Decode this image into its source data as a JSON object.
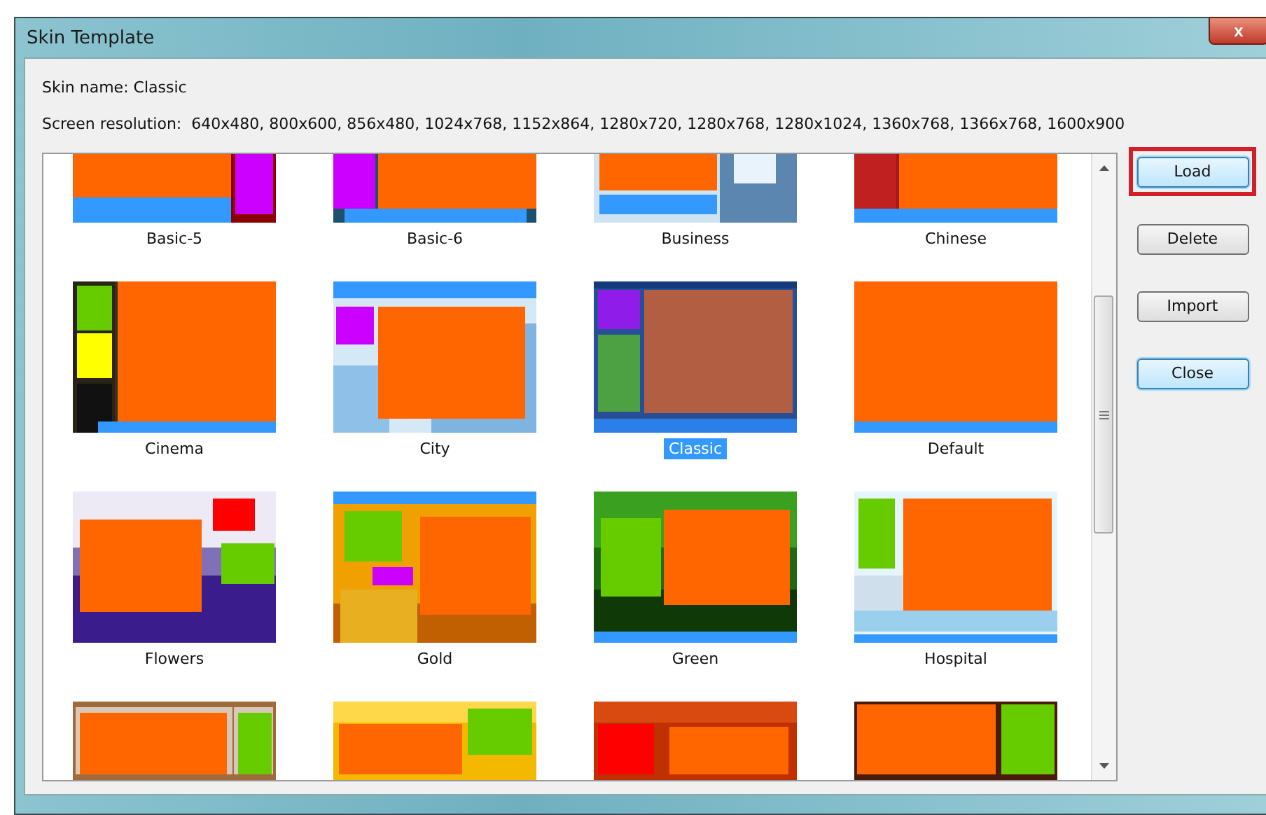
{
  "window": {
    "title": "Skin Template",
    "close_glyph": "x"
  },
  "skin_name": {
    "label": "Skin name:",
    "value": "Classic"
  },
  "screen_resolution": {
    "label": "Screen resolution:",
    "value": "640x480, 800x600, 856x480, 1024x768, 1152x864, 1280x720, 1280x768, 1280x1024, 1360x768, 1366x768, 1600x900"
  },
  "skins": [
    {
      "label": "Basic-5",
      "selected": false
    },
    {
      "label": "Basic-6",
      "selected": false
    },
    {
      "label": "Business",
      "selected": false
    },
    {
      "label": "Chinese",
      "selected": false
    },
    {
      "label": "Cinema",
      "selected": false
    },
    {
      "label": "City",
      "selected": false
    },
    {
      "label": "Classic",
      "selected": true
    },
    {
      "label": "Default",
      "selected": false
    },
    {
      "label": "Flowers",
      "selected": false
    },
    {
      "label": "Gold",
      "selected": false
    },
    {
      "label": "Green",
      "selected": false
    },
    {
      "label": "Hospital",
      "selected": false
    },
    {
      "selected": false
    },
    {
      "selected": false
    },
    {
      "selected": false
    },
    {
      "selected": false
    }
  ],
  "buttons": [
    {
      "label": "Load",
      "highlighted": true,
      "focused": true
    },
    {
      "label": "Delete",
      "highlighted": false,
      "focused": false
    },
    {
      "label": "Import",
      "highlighted": false,
      "focused": false
    },
    {
      "label": "Close",
      "highlighted": false,
      "focused": true
    }
  ]
}
